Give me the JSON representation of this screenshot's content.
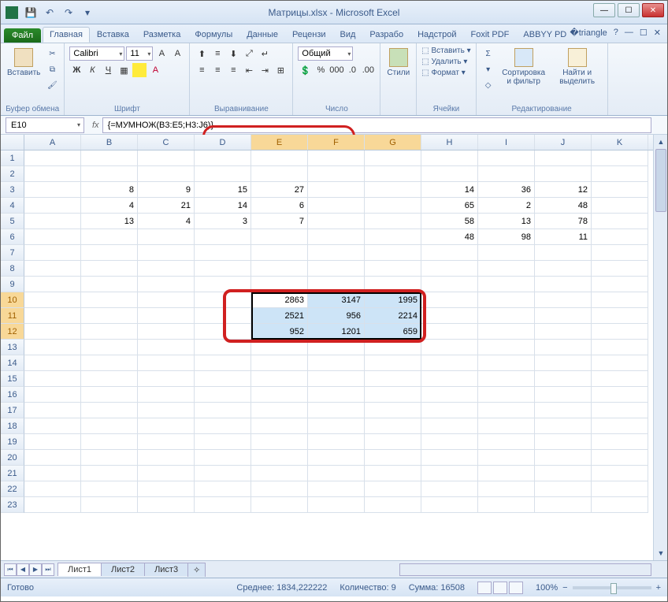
{
  "title": "Матрицы.xlsx - Microsoft Excel",
  "tabs": {
    "file": "Файл",
    "home": "Главная",
    "insert": "Вставка",
    "layout": "Разметка",
    "formulas": "Формулы",
    "data": "Данные",
    "review": "Рецензи",
    "view": "Вид",
    "dev": "Разрабо",
    "addins": "Надстрой",
    "foxit": "Foxit PDF",
    "abbyy": "ABBYY PD"
  },
  "ribbon": {
    "clipboard": {
      "paste": "Вставить",
      "label": "Буфер обмена"
    },
    "font": {
      "name": "Calibri",
      "size": "11",
      "label": "Шрифт",
      "bold": "Ж",
      "italic": "К",
      "under": "Ч"
    },
    "align": {
      "label": "Выравнивание"
    },
    "number": {
      "format": "Общий",
      "label": "Число"
    },
    "styles": {
      "btn": "Стили"
    },
    "cells": {
      "insert": "Вставить",
      "delete": "Удалить",
      "format": "Формат",
      "label": "Ячейки"
    },
    "editing": {
      "sort": "Сортировка и фильтр",
      "find": "Найти и выделить",
      "label": "Редактирование"
    }
  },
  "namebox": "E10",
  "formula": "{=МУМНОЖ(B3:E5;H3:J6)}",
  "columns": [
    "A",
    "B",
    "C",
    "D",
    "E",
    "F",
    "G",
    "H",
    "I",
    "J",
    "K"
  ],
  "rowcount": 23,
  "cells": {
    "r3": {
      "B": "8",
      "C": "9",
      "D": "15",
      "E": "27",
      "H": "14",
      "I": "36",
      "J": "12"
    },
    "r4": {
      "B": "4",
      "C": "21",
      "D": "14",
      "E": "6",
      "H": "65",
      "I": "2",
      "J": "48"
    },
    "r5": {
      "B": "13",
      "C": "4",
      "D": "3",
      "E": "7",
      "H": "58",
      "I": "13",
      "J": "78"
    },
    "r6": {
      "H": "48",
      "I": "98",
      "J": "11"
    },
    "r10": {
      "E": "2863",
      "F": "3147",
      "G": "1995"
    },
    "r11": {
      "E": "2521",
      "F": "956",
      "G": "2214"
    },
    "r12": {
      "E": "952",
      "F": "1201",
      "G": "659"
    }
  },
  "selection": {
    "rows": [
      10,
      11,
      12
    ],
    "cols": [
      "E",
      "F",
      "G"
    ],
    "active": "E10"
  },
  "sheets": {
    "s1": "Лист1",
    "s2": "Лист2",
    "s3": "Лист3"
  },
  "status": {
    "ready": "Готово",
    "avg": "Среднее: 1834,222222",
    "count": "Количество: 9",
    "sum": "Сумма: 16508",
    "zoom": "100%"
  }
}
